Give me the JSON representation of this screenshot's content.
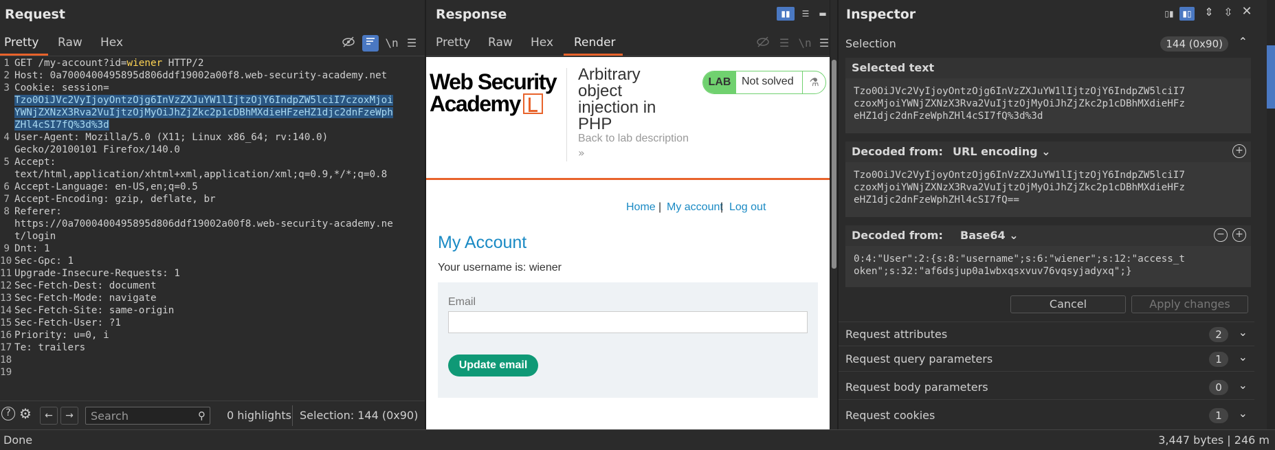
{
  "request": {
    "title": "Request",
    "tabs": [
      "Pretty",
      "Raw",
      "Hex"
    ],
    "newline_icon": "\\n",
    "lines": [
      {
        "n": "1",
        "parts": [
          {
            "t": "GET /my-account?id="
          },
          {
            "t": "wiener",
            "c": "hval"
          },
          {
            "t": " HTTP/2"
          }
        ]
      },
      {
        "n": "2",
        "parts": [
          {
            "t": "Host: 0a7000400495895d806ddf19002a00f8.web-security-academy.net"
          }
        ]
      },
      {
        "n": "3",
        "parts": [
          {
            "t": "Cookie: session="
          }
        ]
      },
      {
        "n": "",
        "parts": [
          {
            "t": "Tzo0OiJVc2VyIjoyOntzOjg6InVzZXJuYW1lIjtzOjY6IndpZW5lciI7czoxMjoi",
            "c": "hl"
          }
        ]
      },
      {
        "n": "",
        "parts": [
          {
            "t": "YWNjZXNzX3Rva2VuIjtzOjMyOiJhZjZkc2p1cDBhMXdieHFzeHZ1djc2dnFzeWph",
            "c": "hl"
          }
        ]
      },
      {
        "n": "",
        "parts": [
          {
            "t": "ZHl4cSI7fQ%3d%3d",
            "c": "hl"
          }
        ]
      },
      {
        "n": "4",
        "parts": [
          {
            "t": "User-Agent: Mozilla/5.0 (X11; Linux x86_64; rv:140.0)"
          }
        ]
      },
      {
        "n": "",
        "parts": [
          {
            "t": "Gecko/20100101 Firefox/140.0"
          }
        ]
      },
      {
        "n": "5",
        "parts": [
          {
            "t": "Accept:"
          }
        ]
      },
      {
        "n": "",
        "parts": [
          {
            "t": "text/html,application/xhtml+xml,application/xml;q=0.9,*/*;q=0.8"
          }
        ]
      },
      {
        "n": "6",
        "parts": [
          {
            "t": "Accept-Language: en-US,en;q=0.5"
          }
        ]
      },
      {
        "n": "7",
        "parts": [
          {
            "t": "Accept-Encoding: gzip, deflate, br"
          }
        ]
      },
      {
        "n": "8",
        "parts": [
          {
            "t": "Referer:"
          }
        ]
      },
      {
        "n": "",
        "parts": [
          {
            "t": "https://0a7000400495895d806ddf19002a00f8.web-security-academy.ne"
          }
        ]
      },
      {
        "n": "",
        "parts": [
          {
            "t": "t/login"
          }
        ]
      },
      {
        "n": "9",
        "parts": [
          {
            "t": "Dnt: 1"
          }
        ]
      },
      {
        "n": "10",
        "parts": [
          {
            "t": "Sec-Gpc: 1"
          }
        ]
      },
      {
        "n": "11",
        "parts": [
          {
            "t": "Upgrade-Insecure-Requests: 1"
          }
        ]
      },
      {
        "n": "12",
        "parts": [
          {
            "t": "Sec-Fetch-Dest: document"
          }
        ]
      },
      {
        "n": "13",
        "parts": [
          {
            "t": "Sec-Fetch-Mode: navigate"
          }
        ]
      },
      {
        "n": "14",
        "parts": [
          {
            "t": "Sec-Fetch-Site: same-origin"
          }
        ]
      },
      {
        "n": "15",
        "parts": [
          {
            "t": "Sec-Fetch-User: ?1"
          }
        ]
      },
      {
        "n": "16",
        "parts": [
          {
            "t": "Priority: u=0, i"
          }
        ]
      },
      {
        "n": "17",
        "parts": [
          {
            "t": "Te: trailers"
          }
        ]
      },
      {
        "n": "18",
        "parts": [
          {
            "t": ""
          }
        ]
      },
      {
        "n": "19",
        "parts": [
          {
            "t": ""
          }
        ]
      }
    ],
    "search_placeholder": "Search",
    "highlights": "0 highlights",
    "selection": "Selection: 144 (0x90)"
  },
  "response": {
    "title": "Response",
    "tabs": [
      "Pretty",
      "Raw",
      "Hex",
      "Render"
    ],
    "newline_icon": "\\n",
    "render": {
      "logo_line1": "Web Security",
      "logo_line2": "Academy",
      "lab_title": "Arbitrary object injection in PHP",
      "back_link": "Back to lab description",
      "back_chevron": "»",
      "badge_lab": "LAB",
      "badge_status": "Not solved",
      "nav_home": "Home",
      "nav_sep": "|",
      "nav_account": "My account",
      "nav_logout": "Log out",
      "heading": "My Account",
      "username_text": "Your username is: wiener",
      "email_label": "Email",
      "update_button": "Update email"
    }
  },
  "inspector": {
    "title": "Inspector",
    "selection_label": "Selection",
    "selection_count": "144 (0x90)",
    "selected_text_label": "Selected text",
    "selected_text_lines": [
      "Tzo0OiJVc2VyIjoyOntzOjg6InVzZXJuYW1lIjtzOjY6IndpZW5lciI7",
      "czoxMjoiYWNjZXNzX3Rva2VuIjtzOjMyOiJhZjZkc2p1cDBhMXdieHFz",
      "eHZ1djc2dnFzeWphZHl4cSI7fQ%3d%3d"
    ],
    "decoded1_label": "Decoded from:",
    "decoded1_type": "URL encoding",
    "decoded1_lines": [
      "Tzo0OiJVc2VyIjoyOntzOjg6InVzZXJuYW1lIjtzOjY6IndpZW5lciI7",
      "czoxMjoiYWNjZXNzX3Rva2VuIjtzOjMyOiJhZjZkc2p1cDBhMXdieHFz",
      "eHZ1djc2dnFzeWphZHl4cSI7fQ=="
    ],
    "decoded2_label": "Decoded from:",
    "decoded2_type": "Base64",
    "decoded2_lines": [
      "0:4:\"User\":2:{s:8:\"username\";s:6:\"wiener\";s:12:\"access_t",
      "oken\";s:32:\"af6dsjup0a1wbxqsxvuv76vqsyjadyxq\";}"
    ],
    "cancel": "Cancel",
    "apply": "Apply changes",
    "rows": [
      {
        "label": "Request attributes",
        "count": "2"
      },
      {
        "label": "Request query parameters",
        "count": "1"
      },
      {
        "label": "Request body parameters",
        "count": "0"
      },
      {
        "label": "Request cookies",
        "count": "1"
      }
    ]
  },
  "status": {
    "left": "Done",
    "right": "3,447 bytes | 246 m"
  },
  "colors": {
    "accent": "#e8632b",
    "selection": "#4a78c2",
    "lab_green": "#70d16f",
    "link_blue": "#1a8ac4",
    "button_teal": "#0f9976"
  }
}
